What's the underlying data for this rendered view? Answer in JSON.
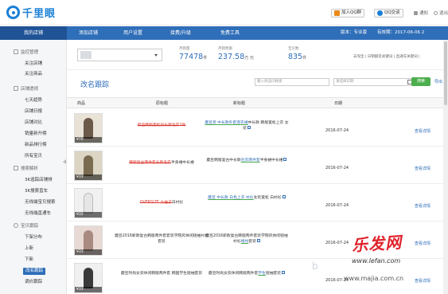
{
  "header": {
    "brand": "千里眼",
    "qq_group": "加入QQ群",
    "qq_chat": "QQ交谈",
    "link_1": "通知",
    "link_2": "退出"
  },
  "nav": {
    "items": [
      "我的店铺",
      "添加店铺",
      "用户设置",
      "接费/升级",
      "免费工具"
    ],
    "active": 0,
    "version_label": "版本：专业版",
    "expiry_label": "有效期：2017-06-06 2"
  },
  "sidebar": {
    "groups": [
      {
        "label": "监控管理",
        "items": [
          "关注店铺",
          "关注商品"
        ]
      },
      {
        "label": "店铺透视",
        "items": [
          "七天趋势",
          "店铺日报",
          "店铺对比",
          "销量新升榜",
          "新品排行榜",
          "所有宝贝"
        ]
      },
      {
        "label": "搜索解析",
        "items": [
          "3K追踪店铺排",
          "3K搜索直车",
          "无线端宝贝搜索",
          "无线端直通车"
        ]
      },
      {
        "label": "宝贝跟踪",
        "items": [
          "下架分布",
          "上新",
          "下新",
          "改名跟踪",
          "调价跟踪"
        ]
      }
    ],
    "active_item": "改名跟踪"
  },
  "stats": {
    "store_label": "",
    "items": [
      {
        "label": "月销量",
        "value": "77478",
        "unit": "件"
      },
      {
        "label": "月销售额",
        "value": "237.58",
        "unit": "万 元"
      },
      {
        "label": "宝贝数",
        "value": "835",
        "unit": "件"
      }
    ],
    "links": "去淘宝 | 日销额及关键词 | 直通车关键词 |"
  },
  "main": {
    "title": "改名跟踪",
    "search_placeholder": "输入商品ID搜索",
    "date_placeholder": "请选择日期",
    "search_button": "搜索",
    "guide_link": "导出"
  },
  "table": {
    "headers": [
      "商品",
      "原标题",
      "新标题",
      "日期"
    ],
    "detail_label": "查看详情",
    "rows": [
      {
        "price": "¥76",
        "orig_del": "新品韩版宽松加长款毛衣2件",
        "orig_rest": "",
        "new_pre": "",
        "new_add": "蘑豆货 中长款外套连衣裙",
        "new_rest": "中长款 韩版宽松上衣 女装",
        "date": "2016-07-24"
      },
      {
        "price": "¥33",
        "orig_del": "韩版复古两件套长款毛衣",
        "orig_rest": "半身裙中长裙",
        "new_pre": "蘑豆韩版复古中长款",
        "new_add": "毛衣两件套",
        "new_rest": "半身裙中长裙",
        "date": "2016-07-24"
      },
      {
        "price": "¥32",
        "orig_del": "OVERSIZE 大袖子",
        "orig_rest": "白衬衫",
        "new_pre": "",
        "new_add": "蘑豆 中长款 白色上衣 衬衫",
        "new_rest": "女装宽松 白衬衫",
        "date": "2016-07-24"
      },
      {
        "price": "¥33",
        "orig_del": "",
        "orig_rest": "蘑豆2016新款复古韩版两件套套装学院风休闲短袖衬衫套装",
        "new_pre": "蘑豆2016新款复古韩版两件套装学院风休闲短袖衬衫",
        "new_add": "格纹",
        "new_rest": "套装",
        "date": "2016-07-24"
      },
      {
        "price": "¥33",
        "orig_del": "",
        "orig_rest": "蘑豆时尚女装休闲韩版两件套 韩国学生短袖套装",
        "new_pre": "蘑豆时尚女装休闲韩版两件套",
        "new_add": "学生",
        "new_rest": "短袖套装",
        "date": "2016-07-24"
      }
    ]
  },
  "watermark": {
    "brand": "乐发网",
    "url": "www.lefan.com",
    "url2": "www.majia.com.cn"
  },
  "colors": {
    "primary": "#2f6eb8",
    "nav_active": "#1f5396",
    "deleted": "#d9342b",
    "added_underline": "#4cae4c",
    "search_button": "#4cae4c"
  }
}
